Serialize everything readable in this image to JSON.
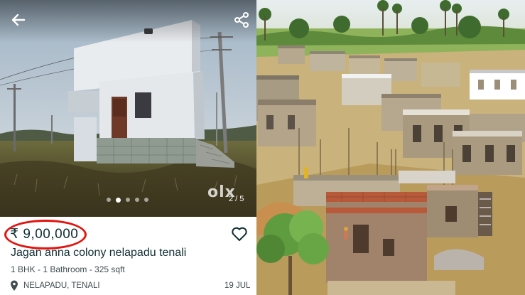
{
  "listing": {
    "price": "₹ 9,00,000",
    "title": "Jagan anna colony nelapadu tenali",
    "specs": "1 BHK - 1 Bathroom - 325 sqft",
    "location": "NELAPADU, TENALI",
    "date": "19 JUL",
    "image_counter": "2 / 5",
    "watermark": "olx",
    "dots_total": 5,
    "dot_active_index": 1
  },
  "icons": {
    "back": "arrow-left-icon",
    "share": "share-icon",
    "favorite": "heart-outline-icon",
    "location": "map-pin-icon"
  },
  "colors": {
    "price_highlight": "#e3140f",
    "text_primary": "#0f2d32",
    "text_secondary": "#3f4d50"
  }
}
